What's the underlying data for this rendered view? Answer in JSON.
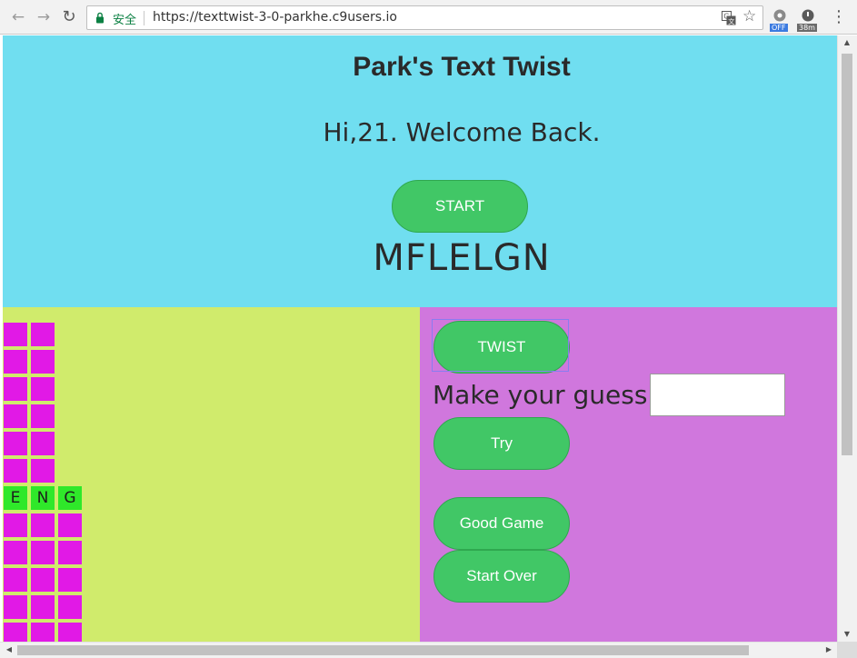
{
  "browser": {
    "secure_label": "安全",
    "url": "https://texttwist-3-0-parkhe.c9users.io",
    "icons": [
      "back-arrow-icon",
      "forward-arrow-icon",
      "reload-icon",
      "lock-icon",
      "translate-icon",
      "star-icon",
      "extension-icon",
      "extension-timer-icon",
      "menu-icon"
    ],
    "extensions": [
      {
        "badge": "OFF",
        "badge_color": "#3c7be0"
      },
      {
        "badge": "38m",
        "badge_color": "#6b6b6b"
      }
    ]
  },
  "header": {
    "title": "Park's Text Twist",
    "welcome": "Hi,21. Welcome Back.",
    "start_label": "START",
    "letters": "MFLELGN"
  },
  "board": {
    "words": [
      {
        "letters": [
          "",
          ""
        ],
        "found": false
      },
      {
        "letters": [
          "",
          ""
        ],
        "found": false
      },
      {
        "letters": [
          "",
          ""
        ],
        "found": false
      },
      {
        "letters": [
          "",
          ""
        ],
        "found": false
      },
      {
        "letters": [
          "",
          ""
        ],
        "found": false
      },
      {
        "letters": [
          "",
          ""
        ],
        "found": false
      },
      {
        "letters": [
          "E",
          "N",
          "G"
        ],
        "found": true
      },
      {
        "letters": [
          "",
          "",
          ""
        ],
        "found": false
      },
      {
        "letters": [
          "",
          "",
          ""
        ],
        "found": false
      },
      {
        "letters": [
          "",
          "",
          ""
        ],
        "found": false
      },
      {
        "letters": [
          "",
          "",
          ""
        ],
        "found": false
      },
      {
        "letters": [
          "",
          "",
          ""
        ],
        "found": false
      }
    ]
  },
  "controls": {
    "twist_label": "TWIST",
    "guess_label": "Make your guess:",
    "guess_value": "",
    "try_label": "Try",
    "good_game_label": "Good Game",
    "start_over_label": "Start Over"
  },
  "colors": {
    "top_panel": "#70def0",
    "left_panel": "#d0eb6c",
    "right_panel": "#d077dd",
    "button": "#41c766",
    "blank_tile": "#e119e6",
    "found_tile": "#2fe82a"
  }
}
